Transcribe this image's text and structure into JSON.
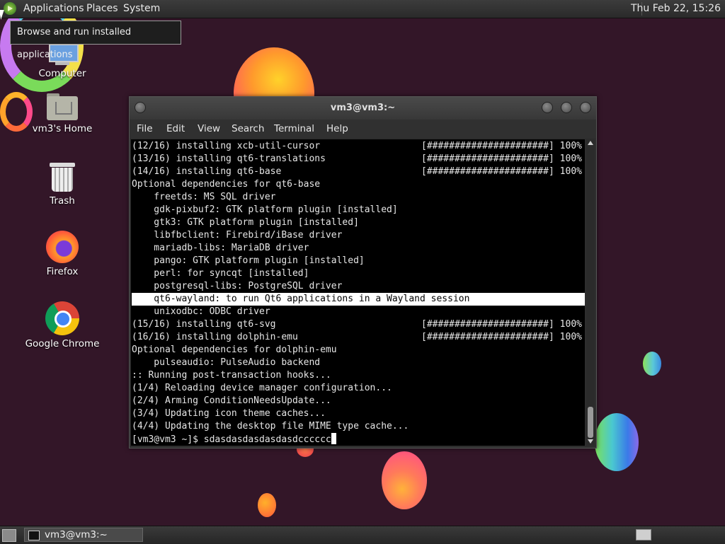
{
  "top_panel": {
    "menus": [
      "Applications",
      "Places",
      "System"
    ],
    "clock": "Thu Feb 22, 15:26",
    "tooltip": "Browse and run installed applications"
  },
  "desktop": {
    "icons": [
      {
        "label": "Computer",
        "icon": "computer-icon"
      },
      {
        "label": "vm3's Home",
        "icon": "home-folder-icon"
      },
      {
        "label": "Trash",
        "icon": "trash-icon"
      },
      {
        "label": "Firefox",
        "icon": "firefox-icon"
      },
      {
        "label": "Google Chrome",
        "icon": "chrome-icon"
      }
    ]
  },
  "terminal": {
    "title": "vm3@vm3:~",
    "menu": [
      "File",
      "Edit",
      "View",
      "Search",
      "Terminal",
      "Help"
    ],
    "lines": [
      {
        "text": "(12/16) installing xcb-util-cursor",
        "bar": "[######################] 100%"
      },
      {
        "text": "(13/16) installing qt6-translations",
        "bar": "[######################] 100%"
      },
      {
        "text": "(14/16) installing qt6-base",
        "bar": "[######################] 100%"
      },
      {
        "text": "Optional dependencies for qt6-base",
        "bar": ""
      },
      {
        "text": "    freetds: MS SQL driver",
        "bar": ""
      },
      {
        "text": "    gdk-pixbuf2: GTK platform plugin [installed]",
        "bar": ""
      },
      {
        "text": "    gtk3: GTK platform plugin [installed]",
        "bar": ""
      },
      {
        "text": "    libfbclient: Firebird/iBase driver",
        "bar": ""
      },
      {
        "text": "    mariadb-libs: MariaDB driver",
        "bar": ""
      },
      {
        "text": "    pango: GTK platform plugin [installed]",
        "bar": ""
      },
      {
        "text": "    perl: for syncqt [installed]",
        "bar": ""
      },
      {
        "text": "    postgresql-libs: PostgreSQL driver",
        "bar": ""
      },
      {
        "text": "    qt6-wayland: to run Qt6 applications in a Wayland session",
        "bar": "",
        "highlight": true
      },
      {
        "text": "    unixodbc: ODBC driver",
        "bar": ""
      },
      {
        "text": "(15/16) installing qt6-svg",
        "bar": "[######################] 100%"
      },
      {
        "text": "(16/16) installing dolphin-emu",
        "bar": "[######################] 100%"
      },
      {
        "text": "Optional dependencies for dolphin-emu",
        "bar": ""
      },
      {
        "text": "    pulseaudio: PulseAudio backend",
        "bar": ""
      },
      {
        "text": ":: Running post-transaction hooks...",
        "bar": ""
      },
      {
        "text": "(1/4) Reloading device manager configuration...",
        "bar": ""
      },
      {
        "text": "(2/4) Arming ConditionNeedsUpdate...",
        "bar": ""
      },
      {
        "text": "(3/4) Updating icon theme caches...",
        "bar": ""
      },
      {
        "text": "(4/4) Updating the desktop file MIME type cache...",
        "bar": ""
      }
    ],
    "prompt": "[vm3@vm3 ~]$ ",
    "input": "sdasdasdasdasdasdcccccc"
  },
  "taskbar": {
    "window_button": "vm3@vm3:~"
  }
}
